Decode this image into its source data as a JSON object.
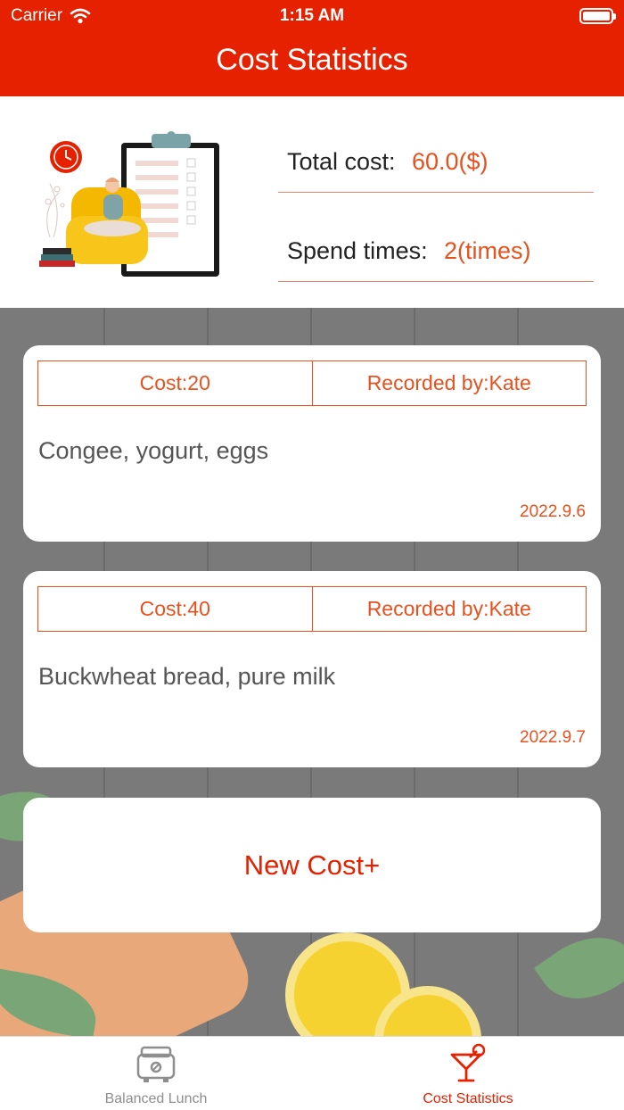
{
  "status_bar": {
    "carrier": "Carrier",
    "time": "1:15 AM"
  },
  "nav": {
    "title": "Cost Statistics"
  },
  "summary": {
    "total_cost_label": "Total cost:",
    "total_cost_value": "60.0($)",
    "spend_times_label": "Spend times:",
    "spend_times_value": "2(times)"
  },
  "records": [
    {
      "cost": "Cost:20",
      "recorded_by": "Recorded by:Kate",
      "description": "Congee, yogurt, eggs",
      "date": "2022.9.6"
    },
    {
      "cost": "Cost:40",
      "recorded_by": "Recorded by:Kate",
      "description": "Buckwheat bread, pure milk",
      "date": "2022.9.7"
    }
  ],
  "actions": {
    "new_cost": "New Cost+"
  },
  "tabbar": {
    "tabs": [
      {
        "label": "Balanced Lunch",
        "icon": "toaster-icon",
        "active": false
      },
      {
        "label": "Cost Statistics",
        "icon": "cocktail-icon",
        "active": true
      }
    ]
  },
  "colors": {
    "brand": "#e52100",
    "accent": "#e8501d",
    "inactive": "#8e8e8e"
  }
}
